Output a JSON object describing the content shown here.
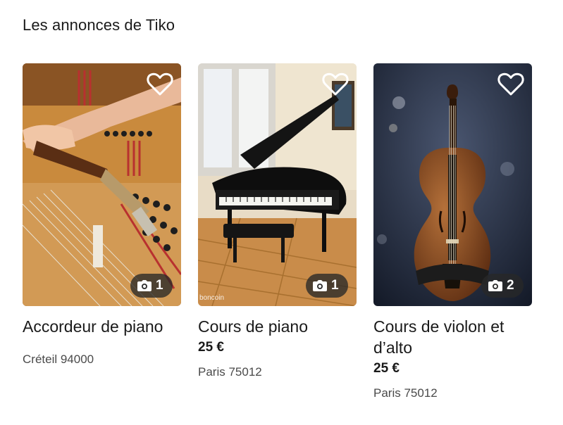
{
  "section": {
    "title": "Les annonces de Tiko"
  },
  "listings": [
    {
      "title": "Accordeur de piano",
      "price": "",
      "location": "Créteil 94000",
      "photo_count": "1",
      "image_subject": "piano-tuning-photo"
    },
    {
      "title": "Cours de piano",
      "price": "25 €",
      "location": "Paris 75012",
      "photo_count": "1",
      "image_subject": "grand-piano-photo",
      "watermark": "boncoin"
    },
    {
      "title": "Cours de violon et d’alto",
      "price": "25 €",
      "location": "Paris 75012",
      "photo_count": "2",
      "image_subject": "violin-photo"
    }
  ],
  "icons": {
    "favorite": "heart-outline-icon",
    "photos": "camera-icon"
  },
  "colors": {
    "text": "#1a1a1a",
    "muted": "#4a4a4a",
    "badge": "#282828"
  }
}
